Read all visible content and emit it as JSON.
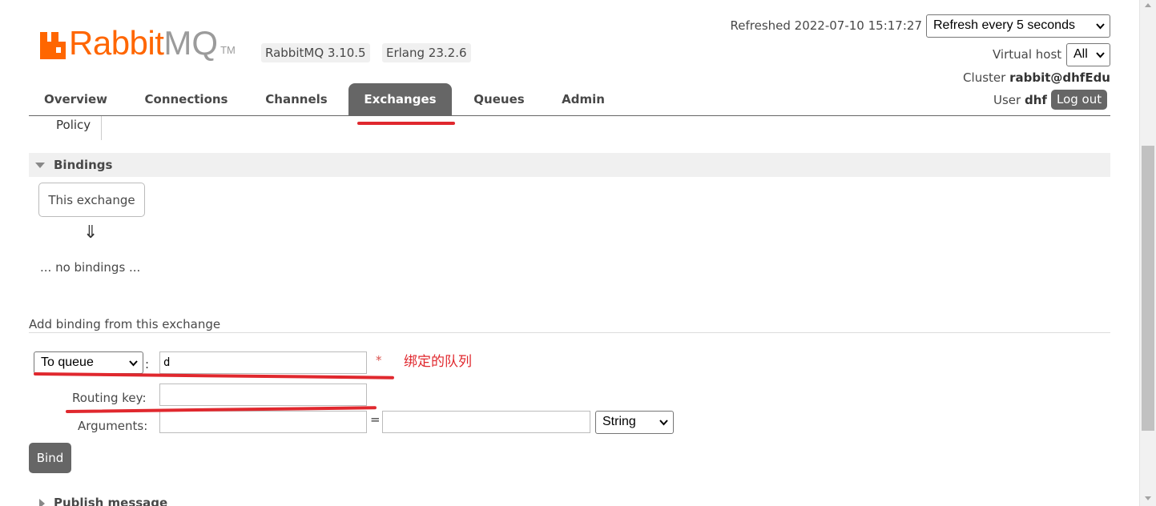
{
  "brand": {
    "name_main": "Rabbit",
    "name_suffix": "MQ",
    "trademark": "TM",
    "color": "#ff6600"
  },
  "versions": {
    "rabbitmq": "RabbitMQ 3.10.5",
    "erlang": "Erlang 23.2.6"
  },
  "header": {
    "refreshed": "Refreshed 2022-07-10 15:17:27",
    "refresh_option": "Refresh every 5 seconds",
    "vhost_label": "Virtual host",
    "vhost_value": "All",
    "cluster_label": "Cluster",
    "cluster_name": "rabbit@dhfEdu",
    "user_label": "User",
    "user_name": "dhf",
    "logout": "Log out"
  },
  "tabs": [
    {
      "label": "Overview",
      "active": false
    },
    {
      "label": "Connections",
      "active": false
    },
    {
      "label": "Channels",
      "active": false
    },
    {
      "label": "Exchanges",
      "active": true
    },
    {
      "label": "Queues",
      "active": false
    },
    {
      "label": "Admin",
      "active": false
    }
  ],
  "subtab": "Policy",
  "bindings": {
    "title": "Bindings",
    "source_box": "This exchange",
    "arrow": "⇓",
    "empty": "... no bindings ..."
  },
  "add_binding": {
    "heading": "Add binding from this exchange",
    "destination_type": "To queue",
    "destination_value": "d",
    "required_mark": "*",
    "annotation": "绑定的队列",
    "routing_key_label": "Routing key:",
    "routing_key_value": "",
    "arguments_label": "Arguments:",
    "arg_key": "",
    "arg_equals": "=",
    "arg_value": "",
    "arg_type": "String",
    "bind_button": "Bind"
  },
  "publish": {
    "title": "Publish message"
  },
  "colors": {
    "annotation_red": "#e0282e",
    "tab_active": "#666666"
  }
}
